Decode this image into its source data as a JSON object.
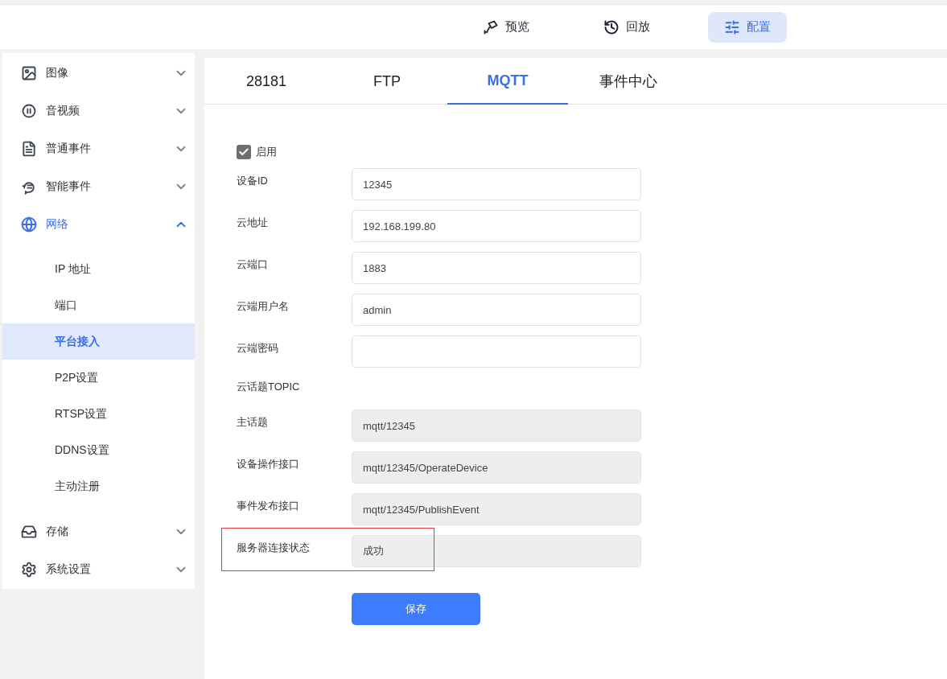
{
  "top_nav": [
    {
      "label": "预览",
      "selected": false
    },
    {
      "label": "回放",
      "selected": false
    },
    {
      "label": "配置",
      "selected": true
    }
  ],
  "sidebar": {
    "items": [
      {
        "label": "图像",
        "expanded": false,
        "selected": false
      },
      {
        "label": "音视频",
        "expanded": false,
        "selected": false
      },
      {
        "label": "普通事件",
        "expanded": false,
        "selected": false
      },
      {
        "label": "智能事件",
        "expanded": false,
        "selected": false
      },
      {
        "label": "网络",
        "expanded": true,
        "selected": true,
        "children": [
          {
            "label": "IP 地址",
            "selected": false
          },
          {
            "label": "端口",
            "selected": false
          },
          {
            "label": "平台接入",
            "selected": true
          },
          {
            "label": "P2P设置",
            "selected": false
          },
          {
            "label": "RTSP设置",
            "selected": false
          },
          {
            "label": "DDNS设置",
            "selected": false
          },
          {
            "label": "主动注册",
            "selected": false
          }
        ]
      },
      {
        "label": "存储",
        "expanded": false,
        "selected": false
      },
      {
        "label": "系统设置",
        "expanded": false,
        "selected": false
      }
    ]
  },
  "tabs": [
    {
      "label": "28181",
      "selected": false
    },
    {
      "label": "FTP",
      "selected": false
    },
    {
      "label": "MQTT",
      "selected": true
    },
    {
      "label": "事件中心",
      "selected": false
    }
  ],
  "form": {
    "rows": [
      {
        "kind": "checkbox",
        "label": "启用",
        "checked": true
      },
      {
        "kind": "input",
        "label": "设备ID",
        "value": "12345",
        "disabled": false,
        "highlighted": false
      },
      {
        "kind": "input",
        "label": "云地址",
        "value": "192.168.199.80",
        "disabled": false,
        "highlighted": false
      },
      {
        "kind": "input",
        "label": "云端口",
        "value": "1883",
        "disabled": false,
        "highlighted": false
      },
      {
        "kind": "input",
        "label": "云端用户名",
        "value": "admin",
        "disabled": false,
        "highlighted": false
      },
      {
        "kind": "input",
        "label": "云端密码",
        "value": "",
        "disabled": false,
        "highlighted": false
      },
      {
        "kind": "heading",
        "label": "云话题TOPIC"
      },
      {
        "kind": "input",
        "label": "主话题",
        "value": "mqtt/12345",
        "disabled": true,
        "highlighted": false
      },
      {
        "kind": "input",
        "label": "设备操作接口",
        "value": "mqtt/12345/OperateDevice",
        "disabled": true,
        "highlighted": false
      },
      {
        "kind": "input",
        "label": "事件发布接口",
        "value": "mqtt/12345/PublishEvent",
        "disabled": true,
        "highlighted": false
      },
      {
        "kind": "input",
        "label": "服务器连接状态",
        "value": "成功",
        "disabled": true,
        "highlighted": true
      }
    ],
    "save_button": "保存"
  }
}
